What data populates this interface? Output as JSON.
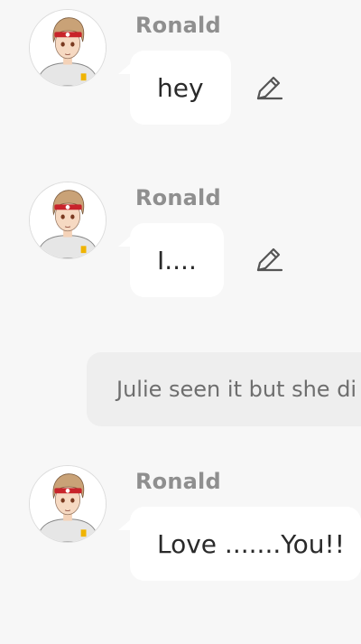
{
  "messages": [
    {
      "sender": "Ronald",
      "text": "hey",
      "editable": true
    },
    {
      "sender": "Ronald",
      "text": "I....",
      "editable": true
    },
    {
      "sender": "Ronald",
      "text": "Love .......You!!",
      "editable": false
    }
  ],
  "narration": {
    "text": "Julie seen it but she di"
  },
  "icons": {
    "edit": "pencil-edit-icon",
    "avatar": "anime-character-avatar"
  },
  "colors": {
    "background": "#f7f7f7",
    "bubble": "#ffffff",
    "narration_bubble": "#eeeeee",
    "sender": "#8f8f8f",
    "text": "#2a2a2a",
    "narration_text": "#6e6e6e",
    "headband": "#c8242b"
  }
}
